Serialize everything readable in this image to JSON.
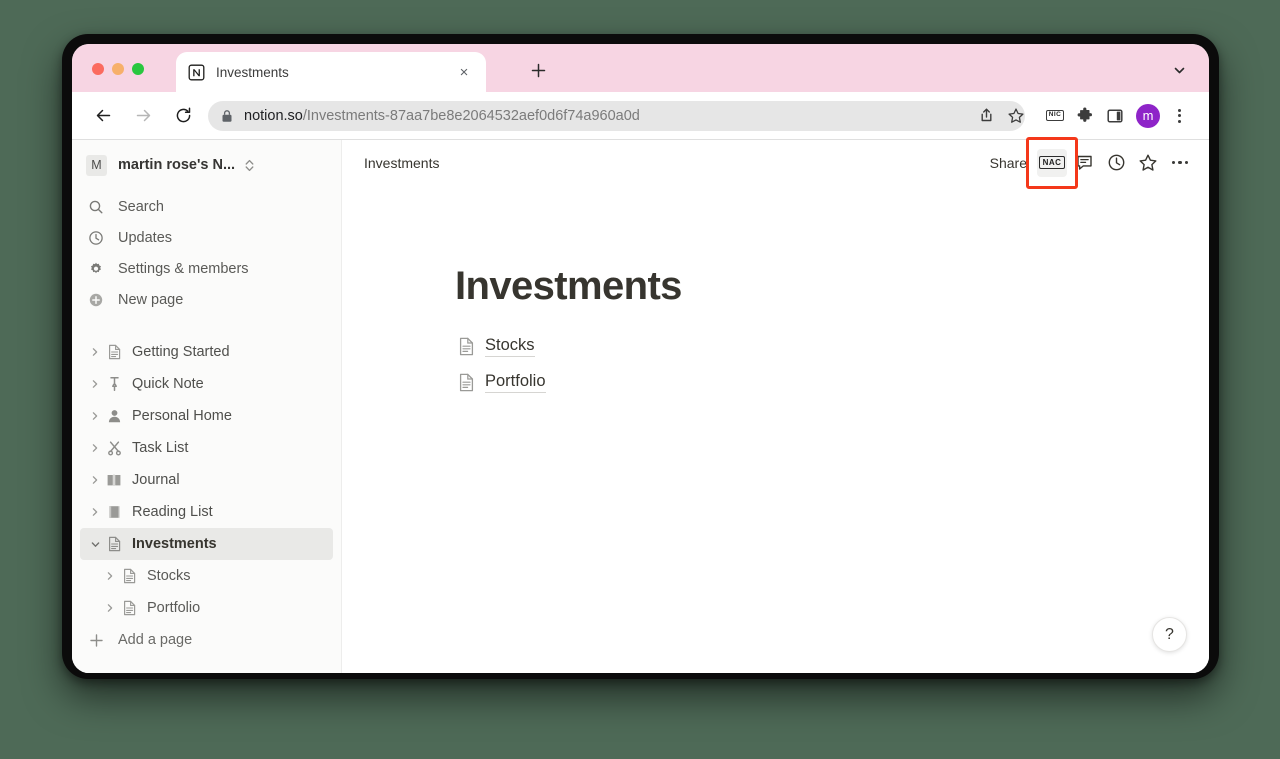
{
  "browser": {
    "tab": {
      "title": "Investments",
      "favicon": "notion-logo-icon",
      "close_label": "×"
    },
    "new_tab_label": "+",
    "nav": {
      "back": "back-arrow-icon",
      "forward": "forward-arrow-icon",
      "reload": "reload-icon"
    },
    "omnibox": {
      "lock": "lock-icon",
      "host": "notion.so",
      "path": "/Investments-87aa7be8e2064532aef0d6f74a960a0d",
      "full_url": "notion.so/Investments-87aa7be8e2064532aef0d6f74a960a0d",
      "share_icon": "share-icon",
      "bookmark_icon": "star-outline-icon"
    },
    "extras": {
      "nic_badge_label": "NIC",
      "extensions_icon": "puzzle-piece-icon",
      "side_panel_icon": "side-panel-icon",
      "profile_initial": "m",
      "profile_color": "#8e24c8",
      "menu_icon": "kebab-menu-icon"
    }
  },
  "sidebar": {
    "workspace": {
      "avatar_initial": "M",
      "name": "martin rose's N...",
      "switcher_icon": "chevron-up-down-icon"
    },
    "actions": [
      {
        "label": "Search",
        "icon": "search-icon"
      },
      {
        "label": "Updates",
        "icon": "clock-icon"
      },
      {
        "label": "Settings & members",
        "icon": "gear-icon"
      },
      {
        "label": "New page",
        "icon": "new-page-plus-circle-icon"
      }
    ],
    "pages": [
      {
        "label": "Getting Started",
        "icon": "📄",
        "icon_name": "document-icon",
        "expanded": false,
        "selected": false,
        "child": false
      },
      {
        "label": "Quick Note",
        "icon": "📌",
        "icon_name": "pushpin-icon",
        "expanded": false,
        "selected": false,
        "child": false
      },
      {
        "label": "Personal Home",
        "icon": "👤",
        "icon_name": "person-icon",
        "expanded": false,
        "selected": false,
        "child": false
      },
      {
        "label": "Task List",
        "icon": "✂",
        "icon_name": "scissors-icon",
        "expanded": false,
        "selected": false,
        "child": false
      },
      {
        "label": "Journal",
        "icon": "📖",
        "icon_name": "open-book-icon",
        "expanded": false,
        "selected": false,
        "child": false
      },
      {
        "label": "Reading List",
        "icon": "📕",
        "icon_name": "closed-book-icon",
        "expanded": false,
        "selected": false,
        "child": false
      },
      {
        "label": "Investments",
        "icon": "📄",
        "icon_name": "document-icon",
        "expanded": true,
        "selected": true,
        "child": false
      },
      {
        "label": "Stocks",
        "icon": "📄",
        "icon_name": "document-icon",
        "expanded": false,
        "selected": false,
        "child": true
      },
      {
        "label": "Portfolio",
        "icon": "📄",
        "icon_name": "document-icon",
        "expanded": false,
        "selected": false,
        "child": true
      }
    ],
    "add_page": {
      "label": "Add a page",
      "icon": "plus-icon"
    }
  },
  "main": {
    "breadcrumb": "Investments",
    "topbar": {
      "share_label": "Share",
      "nac_badge_label": "NAC",
      "comment_icon": "comment-icon",
      "history_icon": "clock-icon",
      "favorite_icon": "star-outline-icon",
      "more_icon": "ellipsis-icon",
      "highlight_color": "#f4381a"
    },
    "title": "Investments",
    "page_links": [
      {
        "label": "Stocks",
        "icon": "document-icon"
      },
      {
        "label": "Portfolio",
        "icon": "document-icon"
      }
    ],
    "help_label": "?"
  },
  "theme": {
    "desktop_background": "#4e6a57",
    "tabstrip_background": "#f7d5e3",
    "sidebar_background": "#fbfbfa",
    "selected_row_background": "#e9e9e7"
  }
}
